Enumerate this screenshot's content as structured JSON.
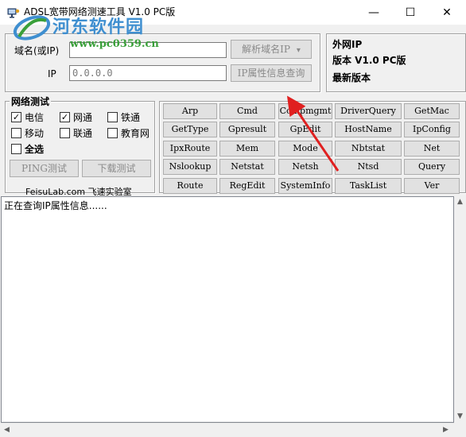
{
  "window": {
    "title": "ADSL宽带网络测速工具 V1.0 PC版",
    "icon": "network-app-icon",
    "min_symbol": "—",
    "max_symbol": "☐",
    "close_symbol": "✕"
  },
  "watermark": {
    "name": "河东软件园",
    "url": "www.pc0359.cn"
  },
  "domain_panel": {
    "domain_label": "域名(或IP)",
    "domain_value": "",
    "resolve_button": "解析域名IP",
    "resolve_arrow": "▾",
    "ip_label": "IP",
    "ip_value": "0.0.0.0",
    "ip_info_button": "IP属性信息查询"
  },
  "info_panel": {
    "external_ip": "外网IP",
    "version": "版本 V1.0 PC版",
    "latest": "最新版本"
  },
  "network_test": {
    "title": "网络测试",
    "checkboxes": [
      {
        "label": "电信",
        "checked": true
      },
      {
        "label": "网通",
        "checked": true
      },
      {
        "label": "铁通",
        "checked": false
      },
      {
        "label": "移动",
        "checked": false
      },
      {
        "label": "联通",
        "checked": false
      },
      {
        "label": "教育网",
        "checked": false
      },
      {
        "label": "全选",
        "checked": false
      }
    ],
    "check_mark": "✓",
    "ping_button": "PING测试",
    "download_button": "下载测试",
    "lab_label": "FeisuLab.com 飞速实验室"
  },
  "commands": {
    "rows": [
      [
        "Arp",
        "Cmd",
        "Compmgmt",
        "DriverQuery",
        "GetMac"
      ],
      [
        "GetType",
        "Gpresult",
        "GpEdit",
        "HostName",
        "IpConfig"
      ],
      [
        "IpxRoute",
        "Mem",
        "Mode",
        "Nbtstat",
        "Net"
      ],
      [
        "Nslookup",
        "Netstat",
        "Netsh",
        "Ntsd",
        "Query"
      ],
      [
        "Route",
        "RegEdit",
        "SystemInfo",
        "TaskList",
        "Ver"
      ]
    ]
  },
  "output": {
    "text": "正在查询IP属性信息......"
  },
  "colors": {
    "annotation_arrow": "#e02020",
    "watermark_blue": "#3f8fd0",
    "watermark_green": "#3aa03a"
  }
}
